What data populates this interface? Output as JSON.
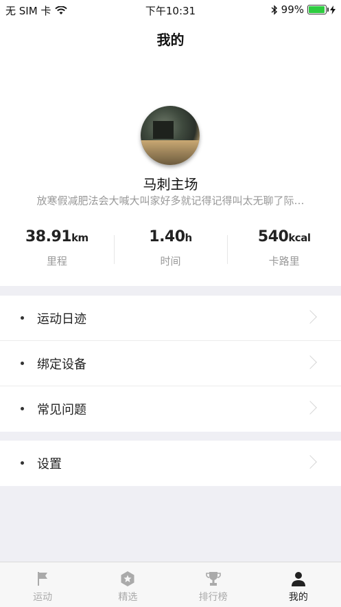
{
  "status_bar": {
    "carrier": "无 SIM 卡",
    "time": "下午10:31",
    "battery": "99%"
  },
  "nav": {
    "title": "我的"
  },
  "profile": {
    "username": "马刺主场",
    "signature": "放寒假减肥法会大喊大叫家好多就记得记得叫太无聊了际…"
  },
  "stats": [
    {
      "value": "38.91",
      "unit": "km",
      "label": "里程"
    },
    {
      "value": "1.40",
      "unit": "h",
      "label": "时间"
    },
    {
      "value": "540",
      "unit": "kcal",
      "label": "卡路里"
    }
  ],
  "menu": {
    "group1": [
      "运动日迹",
      "绑定设备",
      "常见问题"
    ],
    "group2": [
      "设置"
    ]
  },
  "tabs": [
    {
      "label": "运动",
      "icon": "flag-icon"
    },
    {
      "label": "精选",
      "icon": "star-badge-icon"
    },
    {
      "label": "排行榜",
      "icon": "trophy-icon"
    },
    {
      "label": "我的",
      "icon": "person-icon"
    }
  ],
  "colors": {
    "accent": "#222222",
    "inactive": "#aaaaaa",
    "battery": "#2ecc40",
    "background": "#efeff4"
  }
}
